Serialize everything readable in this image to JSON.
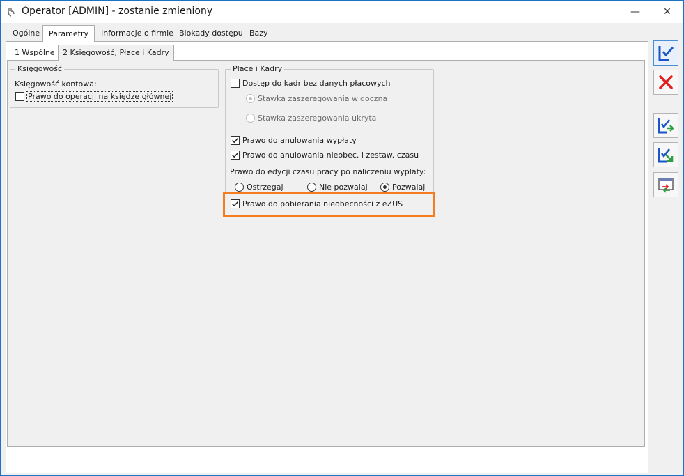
{
  "window": {
    "title": "Operator [ADMIN] - zostanie zmieniony",
    "minimize_label": "—",
    "close_label": "✕"
  },
  "main_tabs": [
    {
      "label": "Ogólne",
      "active": false
    },
    {
      "label": "Parametry",
      "active": true
    },
    {
      "label": "Informacje o firmie",
      "active": false
    },
    {
      "label": "Blokady dostępu",
      "active": false
    },
    {
      "label": "Bazy",
      "active": false
    }
  ],
  "sub_tabs": [
    {
      "label": "1 Wspólne",
      "active": false
    },
    {
      "label": "2 Księgowość, Płace i Kadry",
      "active": true
    }
  ],
  "ksiegowosc": {
    "legend": "Księgowość",
    "sublabel": "Księgowość kontowa:",
    "prawo_operacji": {
      "label": "Prawo do operacji na księdze głównej",
      "checked": false
    }
  },
  "place_kadry": {
    "legend": "Płace i Kadry",
    "dostep_kadr": {
      "label": "Dostęp do kadr bez danych płacowych",
      "checked": false
    },
    "stawka_widoczna": {
      "label": "Stawka zaszeregowania widoczna",
      "selected": true
    },
    "stawka_ukryta": {
      "label": "Stawka zaszeregowania ukryta",
      "selected": false
    },
    "anulowanie_wyplaty": {
      "label": "Prawo do anulowania wypłaty",
      "checked": true
    },
    "anulowanie_nieobec": {
      "label": "Prawo do anulowania nieobec. i zestaw. czasu",
      "checked": true
    },
    "edycja_label": "Prawo do edycji czasu pracy po naliczeniu wypłaty:",
    "edycja_options": [
      {
        "label": "Ostrzegaj",
        "selected": false
      },
      {
        "label": "Nie pozwalaj",
        "selected": false
      },
      {
        "label": "Pozwalaj",
        "selected": true
      }
    ],
    "pobieranie_ezus": {
      "label": "Prawo do pobierania nieobecności z eZUS",
      "checked": true
    }
  },
  "toolbar": {
    "icons": [
      "save-icon",
      "cancel-icon",
      "save-next-icon",
      "save-export-icon",
      "change-icon"
    ]
  },
  "colors": {
    "highlight": "#f57c1f",
    "window_border": "#1c73c4",
    "cancel_red": "#e02020",
    "save_blue": "#1a56c8",
    "arrow_green": "#2ea043"
  }
}
